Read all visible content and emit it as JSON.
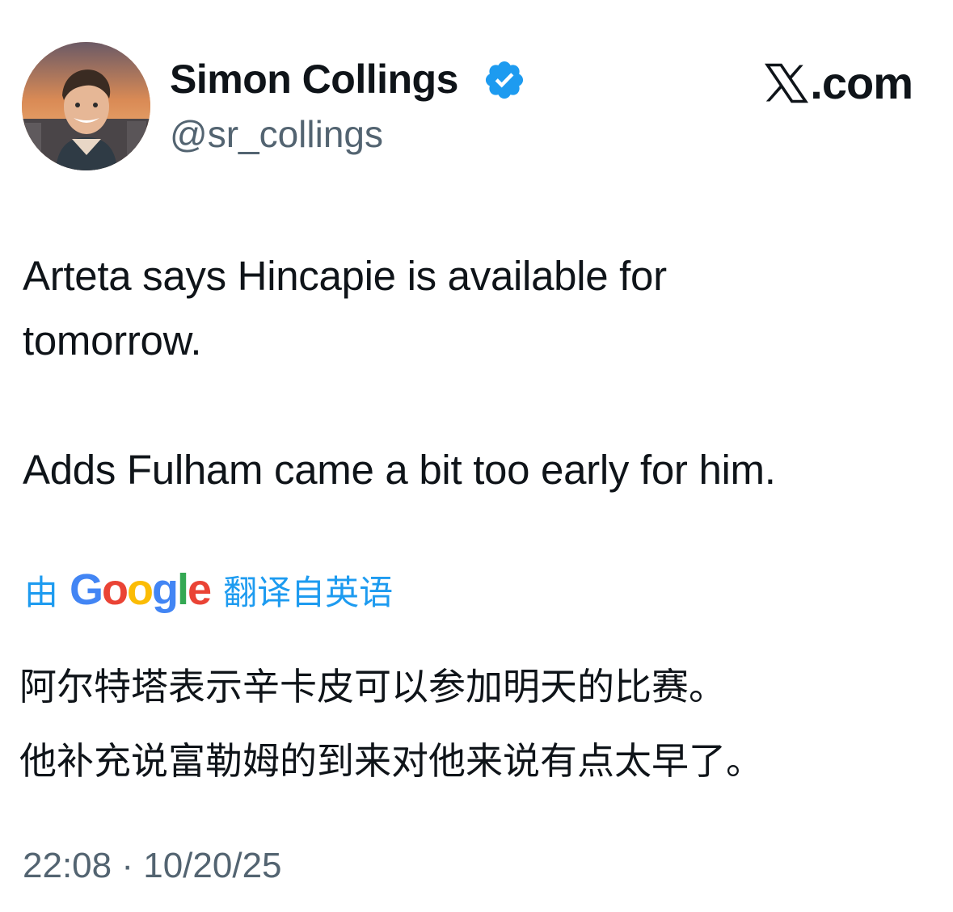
{
  "author": {
    "display_name": "Simon Collings",
    "handle": "@sr_collings",
    "verified": true,
    "badge_color": "#1d9bf0"
  },
  "brand": {
    "label": ".com"
  },
  "tweet": {
    "text": "Arteta says Hincapie is available for\ntomorrow.\n\nAdds Fulham came a bit too early for him."
  },
  "translation": {
    "prefix": "由",
    "provider_letters": [
      "G",
      "o",
      "o",
      "g",
      "l",
      "e"
    ],
    "suffix": "翻译自英语",
    "text": "阿尔特塔表示辛卡皮可以参加明天的比赛。\n他补充说富勒姆的到来对他来说有点太早了。",
    "link_color": "#1d9bf0"
  },
  "meta": {
    "time": "22:08",
    "separator": "·",
    "date": "10/20/25"
  }
}
